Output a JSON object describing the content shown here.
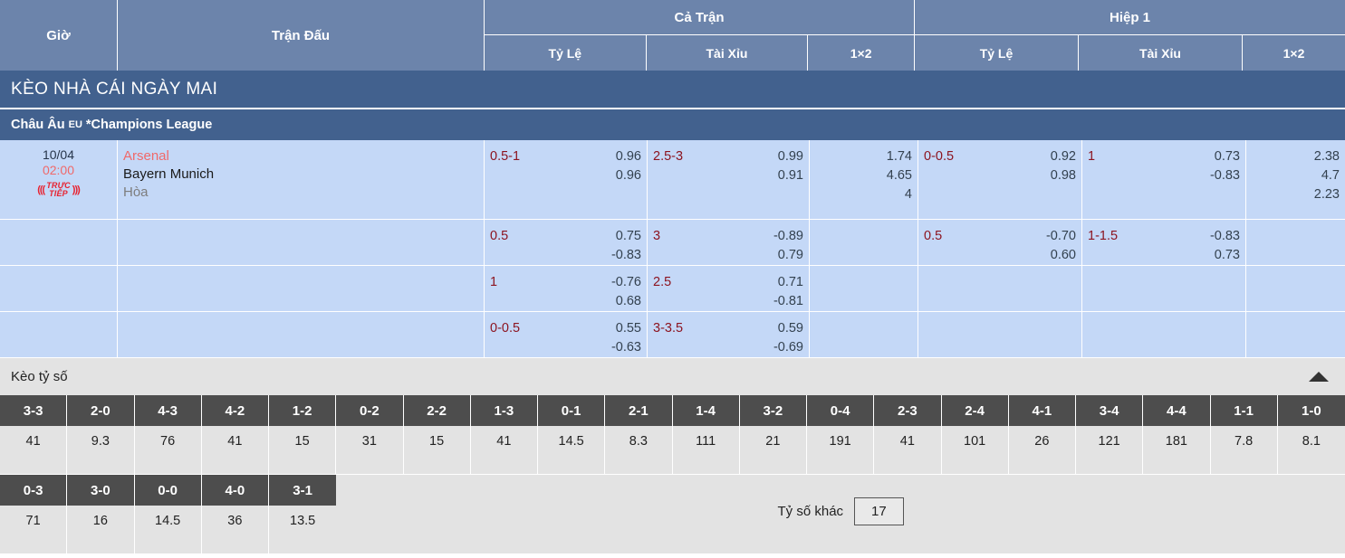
{
  "header": {
    "time_col": "Giờ",
    "match_col": "Trận Đấu",
    "groups": [
      {
        "title": "Cả Trận",
        "subs": [
          "Tỷ Lệ",
          "Tài Xỉu",
          "1×2"
        ]
      },
      {
        "title": "Hiệp 1",
        "subs": [
          "Tỷ Lệ",
          "Tài Xỉu",
          "1×2"
        ]
      }
    ]
  },
  "banner": {
    "title": "KÈO NHÀ CÁI NGÀY MAI"
  },
  "league": {
    "region": "Châu Âu",
    "tag": "EU",
    "name": "*Champions League"
  },
  "match": {
    "date": "10/04",
    "time": "02:00",
    "live_label_line1": "TRỰC",
    "live_label_line2": "TIẾP",
    "home": "Arsenal",
    "away": "Bayern Munich",
    "draw": "Hòa"
  },
  "odds_rows": [
    {
      "ft_handicap": {
        "line": "0.5-1",
        "v1": "0.96",
        "v2": "0.96"
      },
      "ft_ou": {
        "line": "2.5-3",
        "v1": "0.99",
        "v2": "0.91"
      },
      "ft_1x2": {
        "v1": "1.74",
        "v2": "4.65",
        "v3": "4"
      },
      "h1_handicap": {
        "line": "0-0.5",
        "v1": "0.92",
        "v2": "0.98"
      },
      "h1_ou": {
        "line": "1",
        "v1": "0.73",
        "v2": "-0.83"
      },
      "h1_1x2": {
        "v1": "2.38",
        "v2": "4.7",
        "v3": "2.23"
      }
    },
    {
      "ft_handicap": {
        "line": "0.5",
        "v1": "0.75",
        "v2": "-0.83"
      },
      "ft_ou": {
        "line": "3",
        "v1": "-0.89",
        "v2": "0.79"
      },
      "ft_1x2": {
        "v1": "",
        "v2": "",
        "v3": ""
      },
      "h1_handicap": {
        "line": "0.5",
        "v1": "-0.70",
        "v2": "0.60"
      },
      "h1_ou": {
        "line": "1-1.5",
        "v1": "-0.83",
        "v2": "0.73"
      },
      "h1_1x2": {
        "v1": "",
        "v2": "",
        "v3": ""
      }
    },
    {
      "ft_handicap": {
        "line": "1",
        "v1": "-0.76",
        "v2": "0.68"
      },
      "ft_ou": {
        "line": "2.5",
        "v1": "0.71",
        "v2": "-0.81"
      },
      "ft_1x2": {
        "v1": "",
        "v2": "",
        "v3": ""
      },
      "h1_handicap": {
        "line": "",
        "v1": "",
        "v2": ""
      },
      "h1_ou": {
        "line": "",
        "v1": "",
        "v2": ""
      },
      "h1_1x2": {
        "v1": "",
        "v2": "",
        "v3": ""
      }
    },
    {
      "ft_handicap": {
        "line": "0-0.5",
        "v1": "0.55",
        "v2": "-0.63"
      },
      "ft_ou": {
        "line": "3-3.5",
        "v1": "0.59",
        "v2": "-0.69"
      },
      "ft_1x2": {
        "v1": "",
        "v2": "",
        "v3": ""
      },
      "h1_handicap": {
        "line": "",
        "v1": "",
        "v2": ""
      },
      "h1_ou": {
        "line": "",
        "v1": "",
        "v2": ""
      },
      "h1_1x2": {
        "v1": "",
        "v2": "",
        "v3": ""
      }
    }
  ],
  "score_section": {
    "title": "Kèo tỷ số",
    "other_label": "Tỷ số khác",
    "other_value": "17",
    "row1": [
      {
        "score": "3-3",
        "odd": "41"
      },
      {
        "score": "2-0",
        "odd": "9.3"
      },
      {
        "score": "4-3",
        "odd": "76"
      },
      {
        "score": "4-2",
        "odd": "41"
      },
      {
        "score": "1-2",
        "odd": "15"
      },
      {
        "score": "0-2",
        "odd": "31"
      },
      {
        "score": "2-2",
        "odd": "15"
      },
      {
        "score": "1-3",
        "odd": "41"
      },
      {
        "score": "0-1",
        "odd": "14.5"
      },
      {
        "score": "2-1",
        "odd": "8.3"
      },
      {
        "score": "1-4",
        "odd": "111"
      },
      {
        "score": "3-2",
        "odd": "21"
      },
      {
        "score": "0-4",
        "odd": "191"
      },
      {
        "score": "2-3",
        "odd": "41"
      },
      {
        "score": "2-4",
        "odd": "101"
      },
      {
        "score": "4-1",
        "odd": "26"
      },
      {
        "score": "3-4",
        "odd": "121"
      },
      {
        "score": "4-4",
        "odd": "181"
      },
      {
        "score": "1-1",
        "odd": "7.8"
      },
      {
        "score": "1-0",
        "odd": "8.1"
      }
    ],
    "row2": [
      {
        "score": "0-3",
        "odd": "71"
      },
      {
        "score": "3-0",
        "odd": "16"
      },
      {
        "score": "0-0",
        "odd": "14.5"
      },
      {
        "score": "4-0",
        "odd": "36"
      },
      {
        "score": "3-1",
        "odd": "13.5"
      }
    ]
  }
}
